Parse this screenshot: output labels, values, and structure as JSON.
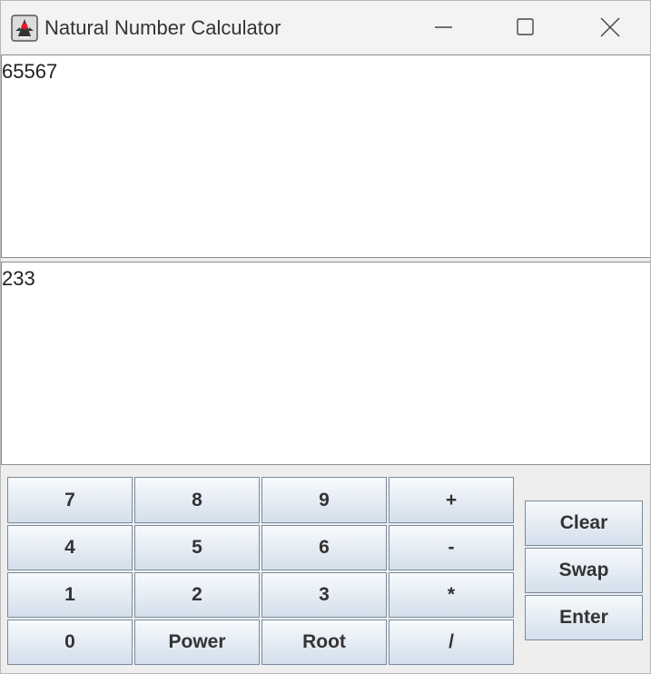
{
  "window": {
    "title": "Natural Number Calculator",
    "app_icon": "java-duke-icon"
  },
  "controls": {
    "minimize_icon": "minimize-icon",
    "maximize_icon": "maximize-icon",
    "close_icon": "close-icon"
  },
  "displays": {
    "top_value": "65567",
    "bottom_value": "233"
  },
  "keypad": {
    "rows": [
      [
        "7",
        "8",
        "9",
        "+"
      ],
      [
        "4",
        "5",
        "6",
        "-"
      ],
      [
        "1",
        "2",
        "3",
        "*"
      ],
      [
        "0",
        "Power",
        "Root",
        "/"
      ]
    ]
  },
  "actions": {
    "clear": "Clear",
    "swap": "Swap",
    "enter": "Enter"
  },
  "colors": {
    "button_border": "#7a8a9c",
    "button_gradient_top": "#f7fafd",
    "button_gradient_bottom": "#d3dfeb",
    "window_bg": "#eeeeee"
  }
}
